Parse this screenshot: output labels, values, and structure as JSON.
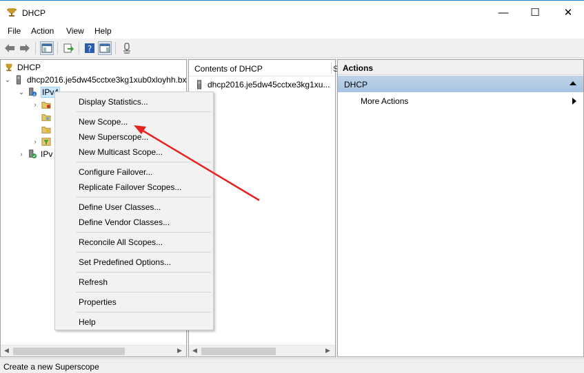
{
  "window": {
    "title": "DHCP",
    "min_glyph": "—",
    "max_glyph": "☐",
    "close_glyph": "✕"
  },
  "menubar": [
    "File",
    "Action",
    "View",
    "Help"
  ],
  "toolbar_icons": [
    "back-icon",
    "forward-icon",
    "show-hide-console-tree-icon",
    "export-list-icon",
    "help-icon",
    "show-hide-action-pane-icon",
    "status-icon"
  ],
  "tree": {
    "root": "DHCP",
    "server": "dhcp2016.je5dw45cctxe3kg1xub0xloyhh.bx",
    "ipv4": "IPv4",
    "ipv6": "IPv"
  },
  "content": {
    "header": "Contents of DHCP",
    "header2": "S",
    "row": "dhcp2016.je5dw45cctxe3kg1xu..."
  },
  "actions": {
    "header": "Actions",
    "group": "DHCP",
    "more": "More Actions"
  },
  "context_menu": [
    "Display Statistics...",
    "New Scope...",
    "New Superscope...",
    "New Multicast Scope...",
    "Configure Failover...",
    "Replicate Failover Scopes...",
    "Define User Classes...",
    "Define Vendor Classes...",
    "Reconcile All Scopes...",
    "Set Predefined Options...",
    "Refresh",
    "Properties",
    "Help"
  ],
  "status": "Create a new Superscope",
  "colors": {
    "selection": "#cce8ff",
    "annotation_arrow": "#e8221c",
    "actions_group": "#bed2e8"
  }
}
